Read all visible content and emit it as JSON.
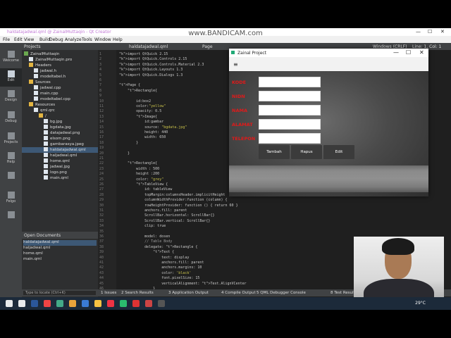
{
  "watermark": "www.BANDICAM.com",
  "qtcreator": {
    "title": "haldatajadwal.qml @ ZainalMuttaqin - Qt Creator",
    "menu": [
      "File",
      "Edit",
      "View",
      "Build",
      "Debug",
      "Analyze",
      "Tools",
      "Window",
      "Help"
    ],
    "modes": [
      "Welcome",
      "Edit",
      "Design",
      "Debug",
      "Projects",
      "Help",
      "",
      "Felgo",
      ""
    ],
    "projects_header": "Projects",
    "editor_tab": "haldatajadwal.qml",
    "crumb": "Page",
    "encoding": "Windows (CRLF)",
    "position": "Line: 1, Col: 1",
    "tree": [
      {
        "label": "ZainalMuttaqin",
        "indent": 0,
        "type": "proj"
      },
      {
        "label": "ZainalMuttaqin.pro",
        "indent": 1,
        "type": "file"
      },
      {
        "label": "Headers",
        "indent": 1,
        "type": "folder"
      },
      {
        "label": "jadwal.h",
        "indent": 2,
        "type": "file"
      },
      {
        "label": "modeltabel.h",
        "indent": 2,
        "type": "file"
      },
      {
        "label": "Sources",
        "indent": 1,
        "type": "folder"
      },
      {
        "label": "jadwal.cpp",
        "indent": 2,
        "type": "file"
      },
      {
        "label": "main.cpp",
        "indent": 2,
        "type": "file"
      },
      {
        "label": "modeltabel.cpp",
        "indent": 2,
        "type": "file"
      },
      {
        "label": "Resources",
        "indent": 1,
        "type": "folder"
      },
      {
        "label": "qml.qrc",
        "indent": 2,
        "type": "file"
      },
      {
        "label": "/",
        "indent": 3,
        "type": "folder"
      },
      {
        "label": "bg.jpg",
        "indent": 4,
        "type": "file"
      },
      {
        "label": "bgdata.jpg",
        "indent": 4,
        "type": "file"
      },
      {
        "label": "datajadwal.png",
        "indent": 4,
        "type": "file"
      },
      {
        "label": "elsom.png",
        "indent": 4,
        "type": "file"
      },
      {
        "label": "gambarasya.jpeg",
        "indent": 4,
        "type": "file"
      },
      {
        "label": "haldatajadwal.qml",
        "indent": 4,
        "type": "file",
        "selected": true
      },
      {
        "label": "haljadwal.qml",
        "indent": 4,
        "type": "file"
      },
      {
        "label": "home.qml",
        "indent": 4,
        "type": "file"
      },
      {
        "label": "jadwal.jpg",
        "indent": 4,
        "type": "file"
      },
      {
        "label": "logo.png",
        "indent": 4,
        "type": "file"
      },
      {
        "label": "main.qml",
        "indent": 4,
        "type": "file"
      }
    ],
    "open_docs_header": "Open Documents",
    "open_docs": [
      "haldatajadwal.qml",
      "haljadwal.qml",
      "home.qml",
      "main.qml"
    ],
    "locator_placeholder": "Type to locate (Ctrl+K)",
    "output_tabs": [
      "1 Issues",
      "2 Search Results",
      "3 Application Output",
      "4 Compile Output",
      "5 QML Debugger Console",
      "8 Test Results"
    ],
    "code_lines": [
      "import QtQuick 2.15",
      "import QtQuick.Controls 2.15",
      "import QtQuick.Controls.Material 2.3",
      "import QtQuick.Layouts 1.3",
      "import QtQuick.Dialogs 1.3",
      "",
      "Page {",
      "    Rectangle{",
      "",
      "        id:box2",
      "        color:\"yellow\"",
      "        opacity: 0.5",
      "        Image{",
      "            id:gambar",
      "            source: \"bgdata.jpg\"",
      "            height: 440",
      "            width: 650",
      "        }",
      "",
      "    }",
      "",
      "    Rectangle{",
      "        width : 500",
      "        height :200",
      "        color: \"grey\"",
      "        TableView {",
      "            id: tableView",
      "            topMargin:columnsHeader.implicitHeight",
      "            columnWidthProvider:function (column) {",
      "            rowHeightProvider: function () { return 60 }",
      "            anchors.fill: parent",
      "            ScrollBar.horizontal: ScrollBar{}",
      "            ScrollBar.vertical: ScrollBar{}",
      "            clip: true",
      "",
      "            model: dosen",
      "            // Table Body",
      "            delegate: Rectangle {",
      "                Text {",
      "                    text: display",
      "                    anchors.fill: parent",
      "                    anchors.margins: 10",
      "                    color: 'black'",
      "                    font.pixelSize: 15",
      "                    verticalAlignment: Text.AlignVCenter",
      "                }",
      "            }",
      "            // Table Header"
    ]
  },
  "app": {
    "title": "Zainal Project",
    "fields": [
      "KODE",
      "NIDN",
      "NAMA",
      "ALAMAT",
      "TELEPON"
    ],
    "buttons": [
      "Tambah",
      "Hapus",
      "Edit"
    ]
  },
  "taskbar": {
    "temperature": "29°C"
  }
}
